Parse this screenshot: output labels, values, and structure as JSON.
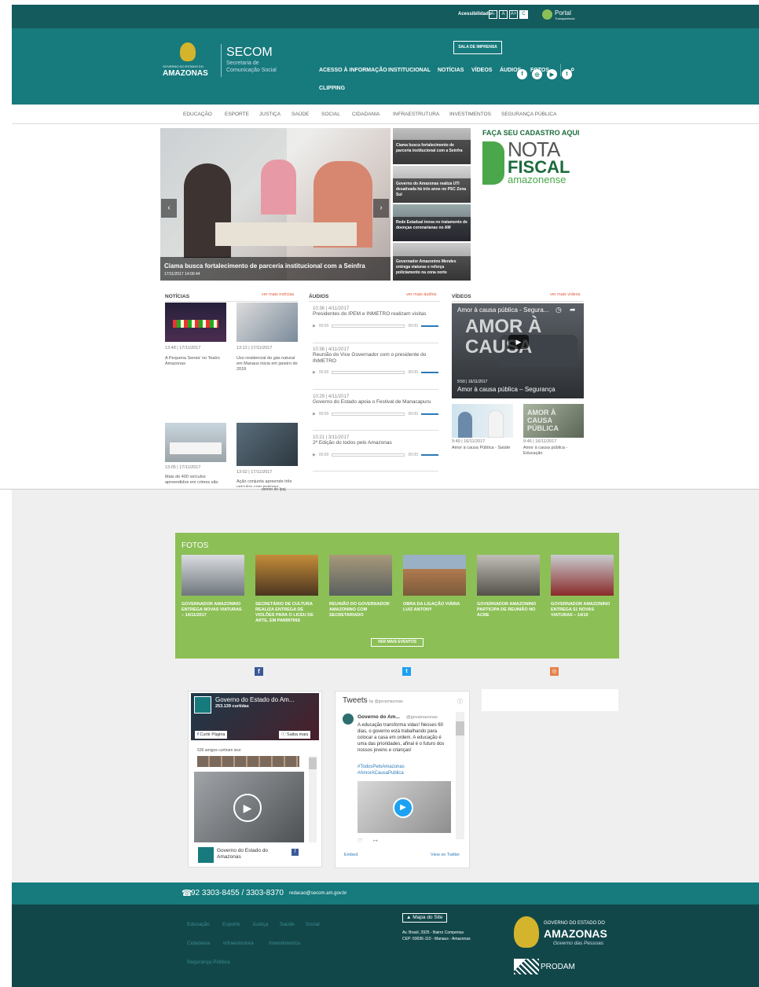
{
  "topbar": {
    "accessibility_label": "Acessibilidade",
    "font_buttons": [
      "A-",
      "A",
      "A+",
      "C"
    ],
    "portal_label": "Portal",
    "portal_sub": "Transparência"
  },
  "header": {
    "gov_small": "GOVERNO DO ESTADO DO",
    "state": "AMAZONAS",
    "secom": "SECOM",
    "secom_sub1": "Secretaria de",
    "secom_sub2": "Comunicação Social",
    "press_room": "SALA DE IMPRENSA",
    "nav": [
      "ACESSO À INFORMAÇÃO",
      "INSTITUCIONAL",
      "NOTÍCIAS",
      "VÍDEOS",
      "ÁUDIOS",
      "FOTOS"
    ],
    "nav_second": "CLIPPING"
  },
  "categories": [
    "EDUCAÇÃO",
    "ESPORTE",
    "JUSTIÇA",
    "SAÚDE",
    "SOCIAL",
    "CIDADANIA",
    "INFRAESTRUTURA",
    "INVESTIMENTOS",
    "SEGURANÇA PÚBLICA"
  ],
  "slider": {
    "caption": "Ciama busca fortalecimento de parceria institucional com a Seinfra",
    "date": "17/11/2017 14:00:44",
    "side": [
      "Ciama busca fortalecimento de parceria institucional com a Seinfra",
      "Governo do Amazonas realiza UTI desativada há três anos no PSC Zona Sul",
      "Rede Estadual inova no tratamento de doenças coronarianas no AM",
      "Governador Amazonino Mendes entrega viaturas e reforça policiamento na zona norte"
    ]
  },
  "banner": {
    "cta": "FAÇA SEU CADASTRO AQUI",
    "line1": "NOTA",
    "line2": "FISCAL",
    "line3": "amazonense"
  },
  "news": {
    "title": "NOTÍCIAS",
    "more": "ver mais notícias",
    "items": [
      {
        "time": "13:48 | 17/11/2017",
        "text": "A Pequena Sereia' no Teatro Amazonas"
      },
      {
        "time": "13:12 | 17/11/2017",
        "text": "Uso residencial do gás natural em Manaus inicia em janeiro de 2018"
      },
      {
        "time": "13:05 | 17/11/2017",
        "text": "Mais de 400 veículos apreendidos em crimes são"
      },
      {
        "time": "13:02 | 17/11/2017",
        "text": "Ação conjunta apreende três veículos com motores"
      }
    ],
    "extra": "dentro do Ipaj"
  },
  "audios": {
    "title": "ÁUDIOS",
    "more": "ver mais áudios",
    "time_label": "00:00",
    "items": [
      {
        "time": "10:36 | 4/11/2017",
        "text": "Presidentes do IPEM e INMETRO realizam visitas"
      },
      {
        "time": "10:36 | 4/11/2017",
        "text": "Reunião do Vice Governador com o presidente do INMETRO"
      },
      {
        "time": "10:29 | 4/11/2017",
        "text": "Governo do Estado apoia o Festival de Manacapuru"
      },
      {
        "time": "10:21 | 3/11/2017",
        "text": "2ª Edição do todos pelo Amazonas"
      }
    ]
  },
  "videos": {
    "title": "VÍDEOS",
    "more": "ver mais vídeos",
    "main_title": "Amor à causa pública - Segura...",
    "main_overlay1": "AMOR À",
    "main_overlay2": "CAUSA",
    "main_time": "9:50 | 16/11/2017",
    "main_caption": "Amor à causa pública – Segurança",
    "items": [
      {
        "time": "9:49 | 16/11/2017",
        "text": "Amor à causa Pública - Saúde"
      },
      {
        "time": "9:46 | 16/11/2017",
        "text": "Amor à causa pública - Educação"
      }
    ],
    "thumb_overlay": "AMOR À CAUSA PÚBLICA"
  },
  "fotos": {
    "title": "FOTOS",
    "items": [
      "GOVERNADOR AMAZONINO ENTREGA NOVAS VIATURAS – 14/11/2017",
      "SECRETÁRIO DE CULTURA REALIZA ENTREGA DE VIOLÕES PARA O LICEU DE ARTE, EM PARINTINS",
      "REUNIÃO DO GOVERNADOR AMAZONINO COM SECRETARIADO",
      "OBRA DA LIGAÇÃO VIÁRIA LUIZ ANTONY",
      "GOVERNADOR AMAZONINO PARTICIPA DE REUNIÃO NO ACRE",
      "GOVERNADOR AMAZONINO ENTREGA 51 NOVAS VIATURAS – 14/10"
    ],
    "button": "VER MAIS EVENTOS"
  },
  "facebook": {
    "page": "Governo do Estado do Am...",
    "likes": "253.139 curtidas",
    "like_btn": "Curtir Página",
    "more_btn": "Saiba mais",
    "friends": "539 amigos curtiram isso",
    "footer_name": "Governo do Estado do Amazonas"
  },
  "twitter": {
    "title": "Tweets",
    "by": "by @govamazonas",
    "user": "Governo do Am...",
    "handle": "@govamazonas",
    "text": "A educação transforma vidas! Nesses 60 dias, o governo está trabalhando para colocar a casa em ordem. A educação é uma das prioridades, afinal é o futuro dos nossos jovens e crianças!",
    "tags": "#TodosPeloAmazonas #AmorACausaPublica",
    "embed": "Embed",
    "view": "View on Twitter"
  },
  "footer": {
    "phone": "92 3303-8455 / 3303-8370",
    "email": "redacao@secom.am.gov.br",
    "links": [
      "Educação",
      "Esporte",
      "Justiça",
      "Saúde",
      "Social",
      "Cidadania",
      "Infraestrutura",
      "Investimentos",
      "Segurança Pública"
    ],
    "sitemap": "Mapa do Site",
    "address1": "Av. Brasil, 3925 - Bairro Compensa",
    "address2": "CEP: 69036-110 - Manaus - Amazonas",
    "gov_small": "GOVERNO DO ESTADO DO",
    "state": "AMAZONAS",
    "slogan": "Governo das Pessoas",
    "prodam": "PRODAM"
  },
  "colors": {
    "teal": "#177a7d",
    "dark_teal": "#12474a",
    "green": "#8cbf56",
    "red": "#e05a3a"
  }
}
